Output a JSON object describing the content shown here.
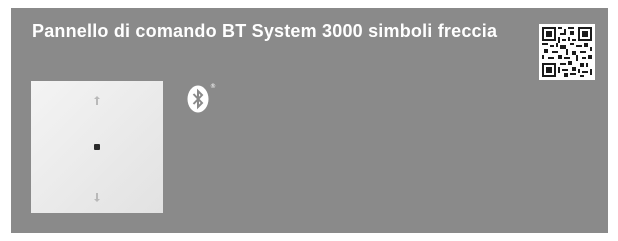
{
  "product": {
    "title": "Pannello di comando BT System 3000 simboli freccia"
  },
  "icons": {
    "qr": "qr-code-icon",
    "bluetooth": "bluetooth-icon",
    "registered_mark": "®",
    "arrow_up": "arrow-up-icon",
    "center_dot": "dot-icon",
    "arrow_down": "arrow-down-icon"
  },
  "colors": {
    "card_background": "#8a8a8a",
    "title_text": "#ffffff",
    "panel_surface": "#eeeeee"
  }
}
